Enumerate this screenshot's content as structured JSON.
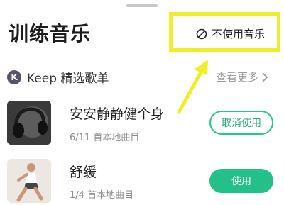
{
  "header": {
    "title": "训练音乐",
    "no_music_label": "不使用音乐"
  },
  "playlist": {
    "logo_letter": "K",
    "label": "Keep 精选歌单",
    "view_more": "查看更多"
  },
  "songs": [
    {
      "title": "安安静静健个身",
      "meta": "6/11 首本地曲目",
      "button": "取消使用"
    },
    {
      "title": "舒缓",
      "meta": "1/4 首本地曲目",
      "button": "使用"
    }
  ],
  "colors": {
    "accent_green": "#23c08a",
    "highlight_yellow": "#f0ee2a",
    "keep_purple": "#5b5169"
  }
}
